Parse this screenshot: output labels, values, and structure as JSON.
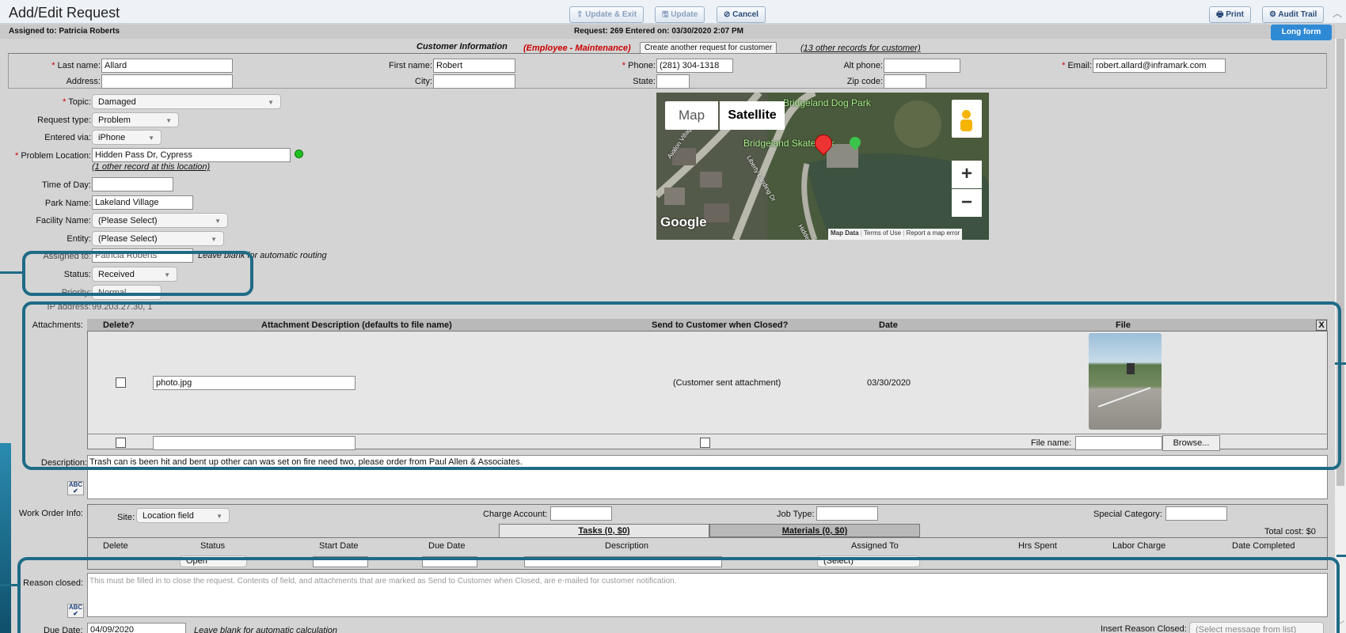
{
  "header": {
    "title": "Add/Edit Request",
    "assigned_to": "Assigned to: Patricia Roberts",
    "request_info": "Request: 269   Entered on: 03/30/2020 2:07 PM",
    "update_exit": "⇪ Update & Exit",
    "update": "🖫 Update",
    "cancel": "⊘ Cancel",
    "print": "🖶 Print",
    "audit_trail": "⚙ Audit Trail",
    "long_form": "Long form"
  },
  "customer": {
    "section_title": "Customer Information",
    "employee_tag": "(Employee - Maintenance)",
    "create_another": "Create another request for customer",
    "other_records": "(13 other records for customer)",
    "last_name_label": "Last name:",
    "last_name": "Allard",
    "first_name_label": "First name:",
    "first_name": "Robert",
    "phone_label": "Phone:",
    "phone": "(281) 304-1318",
    "alt_phone_label": "Alt phone:",
    "alt_phone": "",
    "email_label": "Email:",
    "email": "robert.allard@inframark.com",
    "address_label": "Address:",
    "address": "",
    "city_label": "City:",
    "city": "",
    "state_label": "State:",
    "state": "",
    "zip_label": "Zip code:",
    "zip": ""
  },
  "request": {
    "topic_label": "Topic:",
    "topic": "Damaged",
    "type_label": "Request type:",
    "type": "Problem",
    "entered_via_label": "Entered via:",
    "entered_via": "iPhone",
    "location_label": "Problem Location:",
    "location": "Hidden Pass Dr, Cypress",
    "location_other": "(1 other record at this location)",
    "time_label": "Time of Day:",
    "time": "",
    "park_label": "Park Name:",
    "park": "Lakeland Village",
    "facility_label": "Facility Name:",
    "facility": "(Please Select)",
    "entity_label": "Entity:",
    "entity": "(Please Select)",
    "assigned_partial": "Assigned to:",
    "assigned_value": "Patricia Roberts",
    "assigned_hint": "Leave blank for automatic routing",
    "status_label": "Status:",
    "status": "Received",
    "priority_label": "Priority:",
    "priority": "Normal",
    "ip_label": "IP address:",
    "ip": "99.203.27.30, 1"
  },
  "map": {
    "tab_map": "Map",
    "tab_satellite": "Satellite",
    "place1": "Bridgeland Dog Park",
    "place2": "Bridgeland Skatepark",
    "street1": "Avalon Village Dr",
    "street2": "Liberty Landing Dr",
    "street3": "Hidden",
    "google": "Google",
    "map_data": "Map Data",
    "terms": "Terms of Use",
    "report": "Report a map error",
    "zoom_in": "+",
    "zoom_out": "−"
  },
  "attachments": {
    "label": "Attachments:",
    "headers": [
      "Delete?",
      "Attachment Description (defaults to file name)",
      "Send to Customer when Closed?",
      "Date",
      "File"
    ],
    "close_x": "X",
    "row1": {
      "description": "photo.jpg",
      "send": "(Customer sent attachment)",
      "date": "03/30/2020"
    },
    "file_name_label": "File name:",
    "browse": "Browse..."
  },
  "description": {
    "label": "Description:",
    "text": "Trash can is been hit and bent up other can was set on fire need two, please order from Paul Allen & Associates."
  },
  "work_order": {
    "label": "Work Order Info:",
    "site_label": "Site:",
    "site": "Location field",
    "charge_label": "Charge Account:",
    "job_label": "Job Type:",
    "special_label": "Special Category:",
    "tab_tasks": "Tasks (0, $0)",
    "tab_materials": "Materials (0, $0)",
    "total_cost": "Total cost: $0",
    "headers": [
      "Delete",
      "Status",
      "Start Date",
      "Due Date",
      "Description",
      "Assigned To",
      "Hrs Spent",
      "Labor Charge",
      "Date Completed"
    ],
    "row_status": "Open",
    "row_assigned": "(Select)"
  },
  "closed": {
    "label": "Reason closed:",
    "placeholder": "This must be filled in to close the request.  Contents of field, and attachments that are marked as Send to Customer when Closed, are e-mailed for customer notification.",
    "due_label": "Due Date:",
    "due": "04/09/2020",
    "due_hint": "Leave blank for automatic calculation",
    "insert_label": "Insert Reason Closed:",
    "insert_value": "(Select message from list)"
  },
  "colors": {
    "annotation": "#1e6b86",
    "title_bg": "#e9eef3",
    "assign_bar": "#c9c9c9"
  }
}
